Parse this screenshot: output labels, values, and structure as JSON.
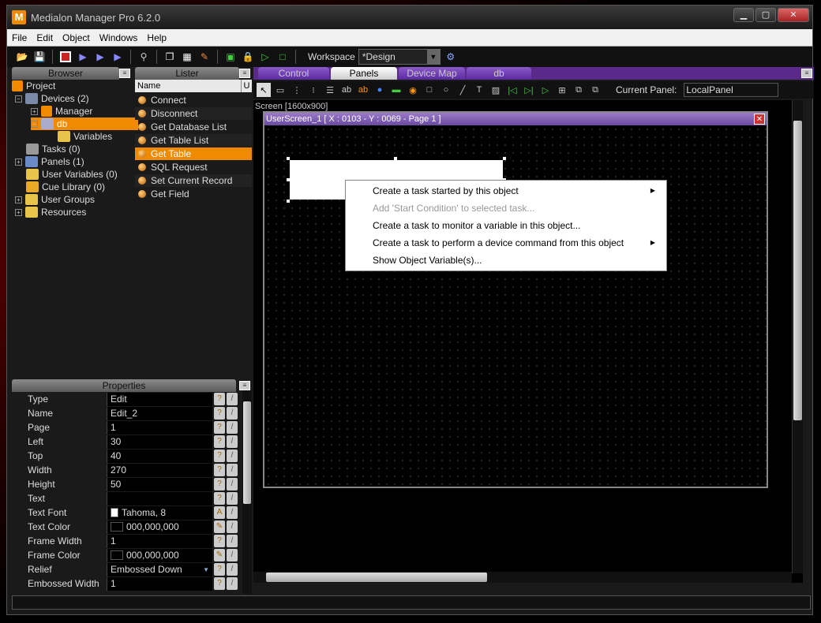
{
  "window": {
    "logo": "M",
    "title": "Medialon Manager Pro 6.2.0",
    "controls": {
      "minimize": "▁",
      "maximize": "▢",
      "close": "✕"
    }
  },
  "menu": [
    "File",
    "Edit",
    "Object",
    "Windows",
    "Help"
  ],
  "toolbar": {
    "workspace_label": "Workspace",
    "workspace_value": "*Design"
  },
  "browser": {
    "header": "Browser",
    "tree": [
      {
        "label": "Project",
        "icon": "project-icon"
      },
      {
        "label": "Devices (2)",
        "icon": "devices-icon"
      },
      {
        "label": "Manager",
        "icon": "manager-icon"
      },
      {
        "label": "db",
        "icon": "database-icon"
      },
      {
        "label": "Variables",
        "icon": "folder-icon"
      },
      {
        "label": "Tasks (0)",
        "icon": "tasks-icon"
      },
      {
        "label": "Panels (1)",
        "icon": "panels-icon"
      },
      {
        "label": "User Variables (0)",
        "icon": "folder-icon"
      },
      {
        "label": "Cue Library (0)",
        "icon": "cue-icon"
      },
      {
        "label": "User Groups",
        "icon": "folder-icon"
      },
      {
        "label": "Resources",
        "icon": "folder-icon"
      }
    ]
  },
  "lister": {
    "header": "Lister",
    "col_name": "Name",
    "col_u": "U",
    "items": [
      "Connect",
      "Disconnect",
      "Get Database List",
      "Get Table List",
      "Get Table",
      "SQL Request",
      "Set Current Record",
      "Get Field"
    ],
    "selected": "Get Table"
  },
  "properties": {
    "header": "Properties",
    "rows": [
      {
        "name": "Type",
        "value": "Edit"
      },
      {
        "name": "Name",
        "value": "Edit_2"
      },
      {
        "name": "Page",
        "value": "1"
      },
      {
        "name": "Left",
        "value": "30"
      },
      {
        "name": "Top",
        "value": "40"
      },
      {
        "name": "Width",
        "value": "270"
      },
      {
        "name": "Height",
        "value": "50"
      },
      {
        "name": "Text",
        "value": ""
      },
      {
        "name": "Text Font",
        "value": "Tahoma, 8"
      },
      {
        "name": "Text Color",
        "value": "000,000,000"
      },
      {
        "name": "Frame Width",
        "value": "1"
      },
      {
        "name": "Frame Color",
        "value": "000,000,000"
      },
      {
        "name": "Relief",
        "value": "Embossed Down"
      },
      {
        "name": "Embossed Width",
        "value": "1"
      }
    ]
  },
  "tabs": [
    "Control",
    "Panels",
    "Device Map",
    "db"
  ],
  "design": {
    "current_panel_label": "Current Panel:",
    "current_panel_value": "LocalPanel",
    "screen_label": "Screen [1600x900]",
    "userscreen_title": "UserScreen_1 [ X : 0103 - Y : 0069 - Page 1 ]"
  },
  "context_menu": [
    {
      "label": "Create a  task started by this object",
      "submenu": true,
      "disabled": false
    },
    {
      "label": "Add 'Start Condition' to selected task...",
      "submenu": false,
      "disabled": true
    },
    {
      "label": "Create a task to monitor a variable in this object...",
      "submenu": false,
      "disabled": false
    },
    {
      "label": "Create a task to perform a device command from this object",
      "submenu": true,
      "disabled": false
    },
    {
      "label": "Show Object Variable(s)...",
      "submenu": false,
      "disabled": false
    }
  ],
  "colors": {
    "accent": "#f08a00",
    "tab_purple": "#6a4aa0"
  }
}
